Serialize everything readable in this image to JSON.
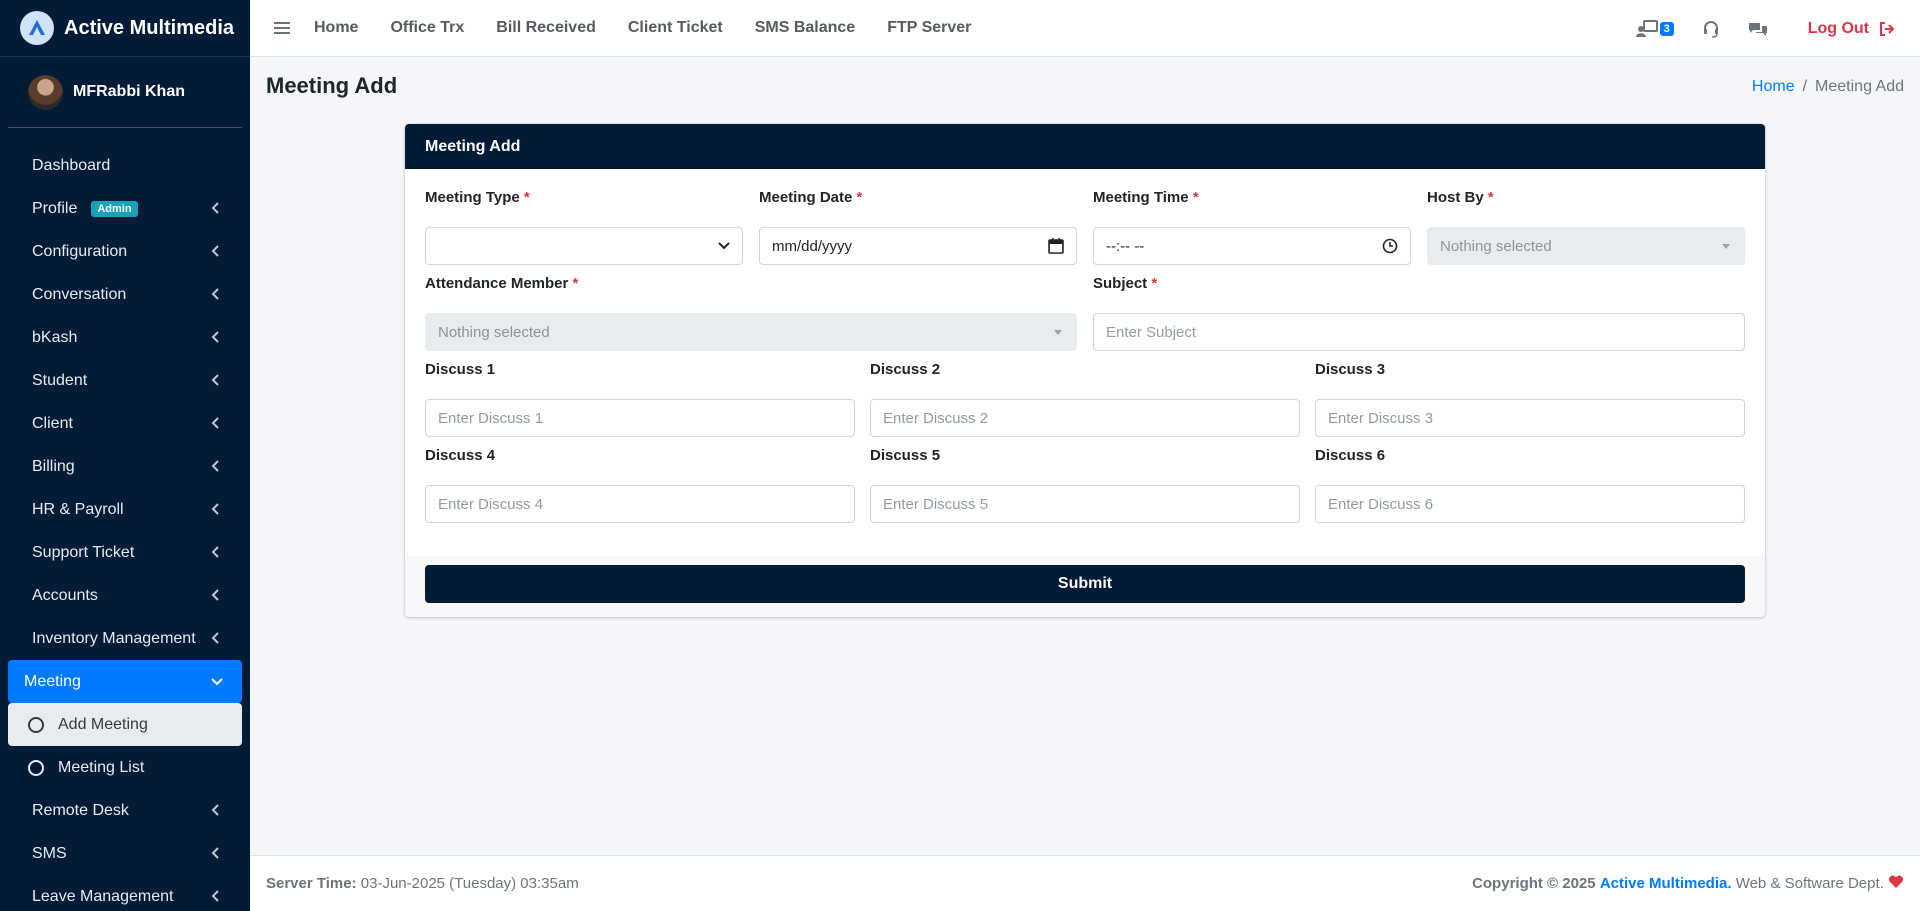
{
  "app": {
    "brand": "Active Multimedia"
  },
  "user": {
    "name": "MFRabbi Khan"
  },
  "sidebar": {
    "items": [
      {
        "label": "Dashboard"
      },
      {
        "label": "Profile",
        "badge": "Admin"
      },
      {
        "label": "Configuration"
      },
      {
        "label": "Conversation"
      },
      {
        "label": "bKash"
      },
      {
        "label": "Student"
      },
      {
        "label": "Client"
      },
      {
        "label": "Billing"
      },
      {
        "label": "HR & Payroll"
      },
      {
        "label": "Support Ticket"
      },
      {
        "label": "Accounts"
      },
      {
        "label": "Inventory Management"
      },
      {
        "label": "Meeting"
      },
      {
        "label": "Remote Desk"
      },
      {
        "label": "SMS"
      },
      {
        "label": "Leave Management"
      }
    ],
    "meeting_sub": [
      {
        "label": "Add Meeting"
      },
      {
        "label": "Meeting List"
      }
    ]
  },
  "topbar": {
    "links": [
      "Home",
      "Office Trx",
      "Bill Received",
      "Client Ticket",
      "SMS Balance",
      "FTP Server"
    ],
    "notification_count": "3",
    "logout": "Log Out"
  },
  "page": {
    "title": "Meeting Add",
    "breadcrumb": {
      "home": "Home",
      "current": "Meeting Add"
    }
  },
  "form": {
    "header": "Meeting Add",
    "required_mark": "*",
    "meeting_type": {
      "label": "Meeting Type",
      "value": ""
    },
    "meeting_date": {
      "label": "Meeting Date",
      "placeholder": "mm/dd/yyyy"
    },
    "meeting_time": {
      "label": "Meeting Time",
      "placeholder": "--:-- --"
    },
    "host_by": {
      "label": "Host By",
      "value": "Nothing selected"
    },
    "attendance": {
      "label": "Attendance Member",
      "value": "Nothing selected"
    },
    "subject": {
      "label": "Subject",
      "placeholder": "Enter Subject"
    },
    "discuss": [
      {
        "label": "Discuss 1",
        "placeholder": "Enter Discuss 1"
      },
      {
        "label": "Discuss 2",
        "placeholder": "Enter Discuss 2"
      },
      {
        "label": "Discuss 3",
        "placeholder": "Enter Discuss 3"
      },
      {
        "label": "Discuss 4",
        "placeholder": "Enter Discuss 4"
      },
      {
        "label": "Discuss 5",
        "placeholder": "Enter Discuss 5"
      },
      {
        "label": "Discuss 6",
        "placeholder": "Enter Discuss 6"
      }
    ],
    "submit": "Submit"
  },
  "footer": {
    "server_time_label": "Server Time:",
    "server_time_value": "03-Jun-2025 (Tuesday) 03:35am",
    "copyright": "Copyright © 2025",
    "company": "Active Multimedia.",
    "dept": "Web & Software Dept."
  },
  "colors": {
    "sidebar_bg": "#021b37",
    "accent": "#007bff",
    "danger": "#dc3545"
  }
}
